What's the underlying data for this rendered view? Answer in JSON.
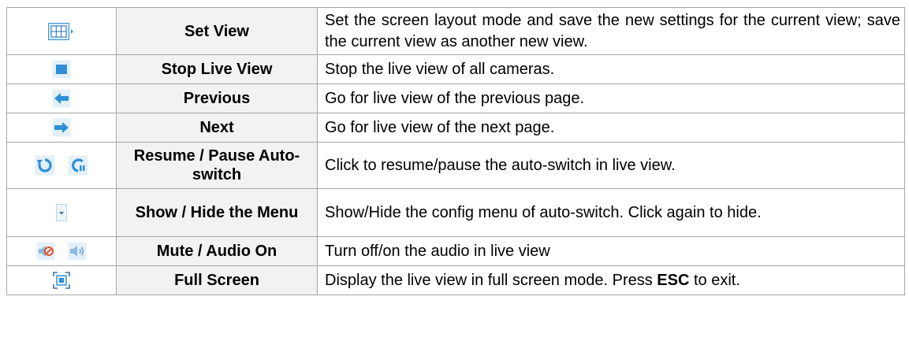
{
  "rows": [
    {
      "icons": [
        "layout-grid-icon"
      ],
      "name": "Set View",
      "desc": "Set the screen layout mode and save the new settings for the current view; save the current view as another new view."
    },
    {
      "icons": [
        "stop-icon"
      ],
      "name": "Stop Live View",
      "desc": "Stop the live view of all cameras."
    },
    {
      "icons": [
        "arrow-left-icon"
      ],
      "name": "Previous",
      "desc": "Go for live view of the previous page."
    },
    {
      "icons": [
        "arrow-right-icon"
      ],
      "name": "Next",
      "desc": "Go for live view of the next page."
    },
    {
      "icons": [
        "resume-icon",
        "pause-icon"
      ],
      "name": "Resume / Pause Auto-switch",
      "desc": "Click to resume/pause the auto-switch in live view."
    },
    {
      "icons": [
        "dropdown-arrow-icon"
      ],
      "name": "Show / Hide the Menu",
      "desc": "Show/Hide the config menu of auto-switch. Click again to hide."
    },
    {
      "icons": [
        "mute-icon",
        "audio-on-icon"
      ],
      "name": "Mute / Audio On",
      "desc": "Turn off/on the audio in live view"
    },
    {
      "icons": [
        "full-screen-icon"
      ],
      "name": "Full Screen",
      "desc_pre": "Display the live view in full screen mode. Press ",
      "desc_key": "ESC",
      "desc_post": " to exit."
    }
  ],
  "colors": {
    "icon_blue": "#2f8fd6",
    "icon_bg": "#dcecf8",
    "name_bg": "#f2f2f2",
    "border": "#a6a6a6"
  }
}
